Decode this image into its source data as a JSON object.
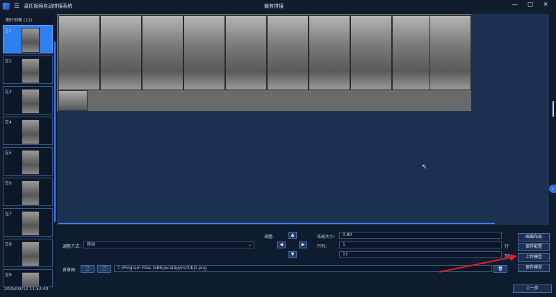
{
  "window": {
    "app_title": "温氏视频自动拼接系统",
    "center_title": "裁剪拼接",
    "minimize": "—",
    "maximize": "▢",
    "close": "✕"
  },
  "sidebar": {
    "header": "图片列表 (11)",
    "items": [
      {
        "label": "左1",
        "active": true
      },
      {
        "label": "左2",
        "active": false
      },
      {
        "label": "左3",
        "active": false
      },
      {
        "label": "左4",
        "active": false
      },
      {
        "label": "左5",
        "active": false
      },
      {
        "label": "左6",
        "active": false
      },
      {
        "label": "左7",
        "active": false
      },
      {
        "label": "左8",
        "active": false
      },
      {
        "label": "左9",
        "active": false
      }
    ]
  },
  "controls": {
    "adjust_mode_label": "调整方式:",
    "adjust_mode_value": "移动",
    "adjust_label": "调整:",
    "layout_size_label": "布局大小:",
    "layout_size_value": "0.80",
    "rowcol_label": "行列:",
    "rows_value": "1",
    "cols_value": "11",
    "row_unit": "行",
    "col_unit": "列",
    "background_label": "背景图:",
    "background_path": "C:/Program Files (x86)/xcalib/pro/3/bj1.png",
    "arrow_up": "▲",
    "arrow_down": "▼",
    "arrow_left": "◀",
    "arrow_right": "▶",
    "file_icon1": "🗋",
    "file_icon2": "🗋",
    "trash_icon": "🗑",
    "dropdown_caret": "⌄"
  },
  "buttons": {
    "canvas_layout": "画面布局",
    "save_config": "保存配置",
    "upload_model": "上传模型",
    "save_model": "保存模型",
    "previous": "上一步"
  },
  "footer": {
    "timestamp": "2025/03/12 11:52:40"
  },
  "colors": {
    "accent": "#2f7ff0",
    "background": "#0f1b2e",
    "canvas": "#1c3151",
    "annotation_arrow": "#e0202a"
  }
}
